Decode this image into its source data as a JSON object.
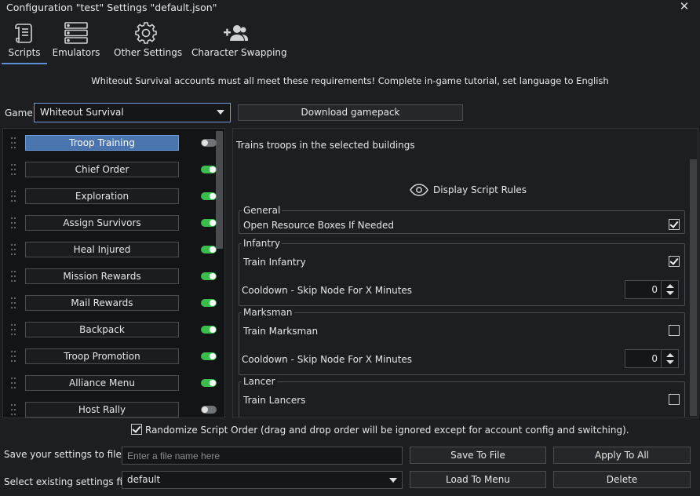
{
  "window": {
    "title": "Configuration \"test\" Settings \"default.json\"",
    "close_glyph": "✕"
  },
  "tabs": [
    {
      "label": "Scripts",
      "icon": "scroll-icon",
      "active": true
    },
    {
      "label": "Emulators",
      "icon": "server-icon",
      "active": false
    },
    {
      "label": "Other Settings",
      "icon": "gear-icon",
      "active": false
    },
    {
      "label": "Character Swapping",
      "icon": "add-user-icon",
      "active": false
    }
  ],
  "requirements": "Whiteout Survival accounts must all meet these requirements! Complete in-game tutorial, set language to English",
  "game": {
    "label": "Game:",
    "value": "Whiteout Survival"
  },
  "download_gamepack": "Download gamepack",
  "scripts": [
    {
      "name": "Troop Training",
      "enabled": false,
      "selected": true
    },
    {
      "name": "Chief Order",
      "enabled": true
    },
    {
      "name": "Exploration",
      "enabled": true
    },
    {
      "name": "Assign Survivors",
      "enabled": true
    },
    {
      "name": "Heal Injured",
      "enabled": true
    },
    {
      "name": "Mission Rewards",
      "enabled": true
    },
    {
      "name": "Mail Rewards",
      "enabled": true
    },
    {
      "name": "Backpack",
      "enabled": true
    },
    {
      "name": "Troop Promotion",
      "enabled": true
    },
    {
      "name": "Alliance Menu",
      "enabled": true
    },
    {
      "name": "Host Rally",
      "enabled": false
    }
  ],
  "details": {
    "description": "Trains troops in the selected buildings",
    "display_rules": "Display Script Rules",
    "general": {
      "title": "General",
      "open_boxes": "Open Resource Boxes If Needed",
      "open_boxes_checked": true
    },
    "infantry": {
      "title": "Infantry",
      "train": "Train Infantry",
      "train_checked": true,
      "cooldown": "Cooldown - Skip Node For X Minutes",
      "cooldown_value": "0"
    },
    "marksman": {
      "title": "Marksman",
      "train": "Train Marksman",
      "train_checked": false,
      "cooldown": "Cooldown - Skip Node For X Minutes",
      "cooldown_value": "0"
    },
    "lancer": {
      "title": "Lancer",
      "train": "Train Lancers",
      "train_checked": false
    }
  },
  "randomize": {
    "label": "Randomize Script Order (drag and drop order will be ignored except for account config and switching).",
    "checked": true
  },
  "save": {
    "label": "Save your settings to file",
    "placeholder": "Enter a file name here",
    "save_btn": "Save To File",
    "apply_btn": "Apply To All"
  },
  "load": {
    "label": "Select existing settings file",
    "value": "default",
    "load_btn": "Load To Menu",
    "delete_btn": "Delete"
  },
  "colors": {
    "accent": "#4a74ad",
    "toggle_on": "#3bbd4b",
    "background": "#1c1e21"
  }
}
